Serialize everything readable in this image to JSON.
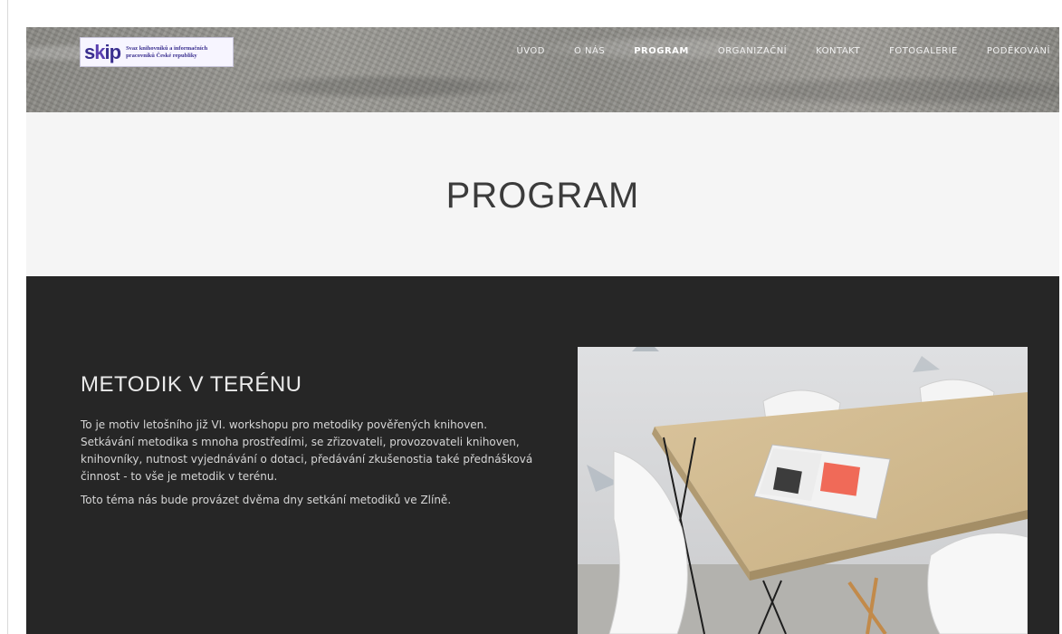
{
  "logo": {
    "mark_s": "s",
    "mark_k": "k",
    "mark_ip": "ip",
    "tagline": "Svaz knihovníků a informačních pracovníků České republiky"
  },
  "nav": {
    "items": [
      {
        "label": "ÚVOD"
      },
      {
        "label": "O NÁS"
      },
      {
        "label": "PROGRAM"
      },
      {
        "label": "ORGANIZAČNÍ"
      },
      {
        "label": "KONTAKT"
      },
      {
        "label": "FOTOGALERIE"
      },
      {
        "label": "PODĚKOVÁNÍ"
      }
    ],
    "active": "PROGRAM"
  },
  "page": {
    "title": "PROGRAM"
  },
  "section": {
    "heading": "METODIK V TERÉNU",
    "paragraph1": "To je motiv letošního již VI. workshopu pro metodiky pověřených knihoven. Setkávání metodika s mnoha prostředími, se zřizovateli, provozovateli knihoven, knihovníky, nutnost vyjednávání o dotaci, předávání zkušenostia také přednášková činnost - to vše je metodik v terénu.",
    "paragraph2": "Toto téma nás bude provázet dvěma dny setkání metodiků ve Zlíně."
  },
  "colors": {
    "dark_section": "#262626",
    "title_band": "#f5f5f5",
    "nav_text": "#f2f2f2",
    "logo_purple": "#3a2f8f"
  }
}
